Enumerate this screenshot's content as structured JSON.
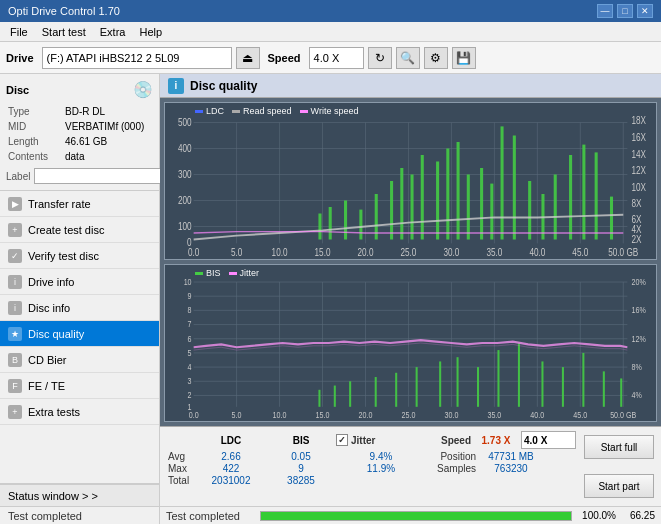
{
  "app": {
    "title": "Opti Drive Control 1.70",
    "title_icon": "💿"
  },
  "title_bar": {
    "title": "Opti Drive Control 1.70",
    "minimize": "—",
    "maximize": "□",
    "close": "✕"
  },
  "menu": {
    "items": [
      "File",
      "Start test",
      "Extra",
      "Help"
    ]
  },
  "toolbar": {
    "drive_label": "Drive",
    "drive_value": "(F:)  ATAPI iHBS212  2 5L09",
    "speed_label": "Speed",
    "speed_value": "4.0 X"
  },
  "disc": {
    "title": "Disc",
    "type_label": "Type",
    "type_value": "BD-R DL",
    "mid_label": "MID",
    "mid_value": "VERBATIMf (000)",
    "length_label": "Length",
    "length_value": "46.61 GB",
    "contents_label": "Contents",
    "contents_value": "data",
    "label_label": "Label",
    "label_value": ""
  },
  "nav_items": [
    {
      "id": "transfer-rate",
      "label": "Transfer rate",
      "active": false
    },
    {
      "id": "create-test-disc",
      "label": "Create test disc",
      "active": false
    },
    {
      "id": "verify-test-disc",
      "label": "Verify test disc",
      "active": false
    },
    {
      "id": "drive-info",
      "label": "Drive info",
      "active": false
    },
    {
      "id": "disc-info",
      "label": "Disc info",
      "active": false
    },
    {
      "id": "disc-quality",
      "label": "Disc quality",
      "active": true
    },
    {
      "id": "cd-bier",
      "label": "CD Bier",
      "active": false
    },
    {
      "id": "fe-te",
      "label": "FE / TE",
      "active": false
    },
    {
      "id": "extra-tests",
      "label": "Extra tests",
      "active": false
    }
  ],
  "status_window": {
    "label": "Status window > >"
  },
  "progress": {
    "percent": 100.0,
    "percent_text": "100.0%",
    "value_text": "66.25"
  },
  "disc_quality": {
    "title": "Disc quality",
    "icon": "i",
    "legend": {
      "ldc": {
        "label": "LDC",
        "color": "#4466ff"
      },
      "read_speed": {
        "label": "Read speed",
        "color": "#dddddd"
      },
      "write_speed": {
        "label": "Write speed",
        "color": "#ff88ff"
      }
    },
    "legend2": {
      "bis": {
        "label": "BIS",
        "color": "#44cc44"
      },
      "jitter": {
        "label": "Jitter",
        "color": "#ff88ff"
      }
    },
    "chart1_y_left": [
      "500",
      "400",
      "300",
      "200",
      "100",
      "0"
    ],
    "chart1_y_right": [
      "18X",
      "16X",
      "14X",
      "12X",
      "10X",
      "8X",
      "6X",
      "4X",
      "2X"
    ],
    "chart2_y_left": [
      "10",
      "9",
      "8",
      "7",
      "6",
      "5",
      "4",
      "3",
      "2",
      "1"
    ],
    "chart2_y_right": [
      "20%",
      "16%",
      "12%",
      "8%",
      "4%"
    ],
    "x_labels": [
      "0.0",
      "5.0",
      "10.0",
      "15.0",
      "20.0",
      "25.0",
      "30.0",
      "35.0",
      "40.0",
      "45.0",
      "50.0 GB"
    ]
  },
  "stats": {
    "col_headers": [
      "LDC",
      "BIS",
      "",
      "Jitter",
      "Speed",
      "1.73 X"
    ],
    "avg_label": "Avg",
    "avg_ldc": "2.66",
    "avg_bis": "0.05",
    "avg_jitter": "9.4%",
    "max_label": "Max",
    "max_ldc": "422",
    "max_bis": "9",
    "max_jitter": "11.9%",
    "total_label": "Total",
    "total_ldc": "2031002",
    "total_bis": "38285",
    "position_label": "Position",
    "position_val": "47731 MB",
    "samples_label": "Samples",
    "samples_val": "763230",
    "speed_select": "4.0 X",
    "jitter_checked": true,
    "jitter_label": "Jitter"
  },
  "buttons": {
    "start_full": "Start full",
    "start_part": "Start part"
  },
  "status_bar": {
    "text": "Test completed",
    "progress_pct": 100,
    "progress_val": "100.0%",
    "right_val": "66.25"
  }
}
